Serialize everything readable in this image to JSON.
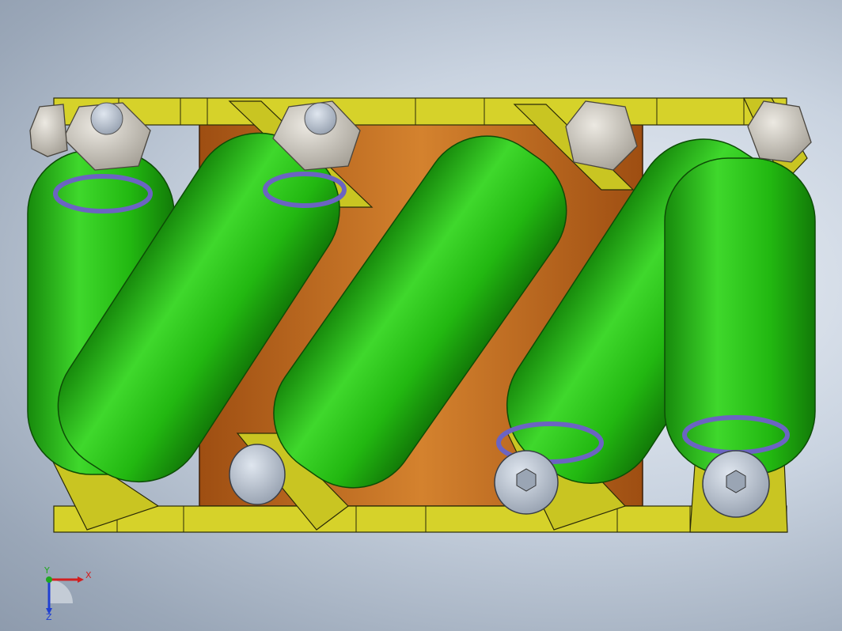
{
  "viewport": {
    "background_colors": [
      "#eef2f8",
      "#9aa7b8"
    ]
  },
  "model": {
    "description_parts": [
      "frame",
      "base-plate",
      "roller-1",
      "roller-2",
      "roller-3",
      "roller-4",
      "hex-nut",
      "socket-head-cap-screw"
    ],
    "colors": {
      "frame": "#d6d22a",
      "frame_dark": "#a6a21a",
      "base_plate": "#c26a1c",
      "roller": "#25c414",
      "roller_dark": "#178a0c",
      "bushing": "#6b64c2",
      "nut": "#c8c4bc",
      "bolt_head": "#b9c4d2"
    }
  },
  "triad": {
    "x_label": "X",
    "y_label": "Y",
    "z_label": "Z",
    "x_color": "#d21f1f",
    "y_color": "#1fa81f",
    "z_color": "#1f3fd2"
  }
}
